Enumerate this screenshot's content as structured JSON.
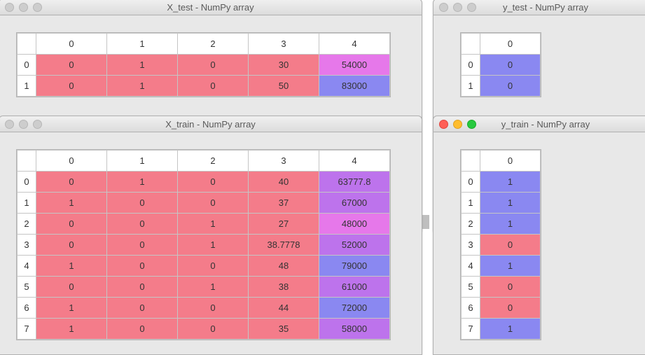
{
  "windows": {
    "x_test": {
      "title": "X_test - NumPy array",
      "active": false,
      "columns": [
        "0",
        "1",
        "2",
        "3",
        "4"
      ],
      "index": [
        "0",
        "1"
      ],
      "cells": [
        [
          {
            "v": "0",
            "c": "red"
          },
          {
            "v": "1",
            "c": "red"
          },
          {
            "v": "0",
            "c": "red"
          },
          {
            "v": "30",
            "c": "red"
          },
          {
            "v": "54000",
            "c": "mag"
          }
        ],
        [
          {
            "v": "0",
            "c": "red"
          },
          {
            "v": "1",
            "c": "red"
          },
          {
            "v": "0",
            "c": "red"
          },
          {
            "v": "50",
            "c": "red"
          },
          {
            "v": "83000",
            "c": "blu"
          }
        ]
      ]
    },
    "y_test": {
      "title": "y_test - NumPy array",
      "active": false,
      "columns": [
        "0"
      ],
      "index": [
        "0",
        "1"
      ],
      "cells": [
        [
          {
            "v": "0",
            "c": "blu"
          }
        ],
        [
          {
            "v": "0",
            "c": "blu"
          }
        ]
      ]
    },
    "x_train": {
      "title": "X_train - NumPy array",
      "active": false,
      "columns": [
        "0",
        "1",
        "2",
        "3",
        "4"
      ],
      "index": [
        "0",
        "1",
        "2",
        "3",
        "4",
        "5",
        "6",
        "7"
      ],
      "cells": [
        [
          {
            "v": "0",
            "c": "red"
          },
          {
            "v": "1",
            "c": "red"
          },
          {
            "v": "0",
            "c": "red"
          },
          {
            "v": "40",
            "c": "red"
          },
          {
            "v": "63777.8",
            "c": "prp"
          }
        ],
        [
          {
            "v": "1",
            "c": "red"
          },
          {
            "v": "0",
            "c": "red"
          },
          {
            "v": "0",
            "c": "red"
          },
          {
            "v": "37",
            "c": "red"
          },
          {
            "v": "67000",
            "c": "prp"
          }
        ],
        [
          {
            "v": "0",
            "c": "red"
          },
          {
            "v": "0",
            "c": "red"
          },
          {
            "v": "1",
            "c": "red"
          },
          {
            "v": "27",
            "c": "red"
          },
          {
            "v": "48000",
            "c": "mag"
          }
        ],
        [
          {
            "v": "0",
            "c": "red"
          },
          {
            "v": "0",
            "c": "red"
          },
          {
            "v": "1",
            "c": "red"
          },
          {
            "v": "38.7778",
            "c": "red"
          },
          {
            "v": "52000",
            "c": "prp"
          }
        ],
        [
          {
            "v": "1",
            "c": "red"
          },
          {
            "v": "0",
            "c": "red"
          },
          {
            "v": "0",
            "c": "red"
          },
          {
            "v": "48",
            "c": "red"
          },
          {
            "v": "79000",
            "c": "blu"
          }
        ],
        [
          {
            "v": "0",
            "c": "red"
          },
          {
            "v": "0",
            "c": "red"
          },
          {
            "v": "1",
            "c": "red"
          },
          {
            "v": "38",
            "c": "red"
          },
          {
            "v": "61000",
            "c": "prp"
          }
        ],
        [
          {
            "v": "1",
            "c": "red"
          },
          {
            "v": "0",
            "c": "red"
          },
          {
            "v": "0",
            "c": "red"
          },
          {
            "v": "44",
            "c": "red"
          },
          {
            "v": "72000",
            "c": "blu"
          }
        ],
        [
          {
            "v": "1",
            "c": "red"
          },
          {
            "v": "0",
            "c": "red"
          },
          {
            "v": "0",
            "c": "red"
          },
          {
            "v": "35",
            "c": "red"
          },
          {
            "v": "58000",
            "c": "prp"
          }
        ]
      ]
    },
    "y_train": {
      "title": "y_train - NumPy array",
      "active": true,
      "columns": [
        "0"
      ],
      "index": [
        "0",
        "1",
        "2",
        "3",
        "4",
        "5",
        "6",
        "7"
      ],
      "cells": [
        [
          {
            "v": "1",
            "c": "blu"
          }
        ],
        [
          {
            "v": "1",
            "c": "blu"
          }
        ],
        [
          {
            "v": "1",
            "c": "blu"
          }
        ],
        [
          {
            "v": "0",
            "c": "red"
          }
        ],
        [
          {
            "v": "1",
            "c": "blu"
          }
        ],
        [
          {
            "v": "0",
            "c": "red"
          }
        ],
        [
          {
            "v": "0",
            "c": "red"
          }
        ],
        [
          {
            "v": "1",
            "c": "blu"
          }
        ]
      ]
    }
  },
  "chart_data": [
    {
      "type": "table",
      "name": "X_test",
      "columns": [
        0,
        1,
        2,
        3,
        4
      ],
      "rows": [
        [
          0,
          1,
          0,
          30,
          54000
        ],
        [
          0,
          1,
          0,
          50,
          83000
        ]
      ]
    },
    {
      "type": "table",
      "name": "y_test",
      "columns": [
        0
      ],
      "rows": [
        [
          0
        ],
        [
          0
        ]
      ]
    },
    {
      "type": "table",
      "name": "X_train",
      "columns": [
        0,
        1,
        2,
        3,
        4
      ],
      "rows": [
        [
          0,
          1,
          0,
          40,
          63777.8
        ],
        [
          1,
          0,
          0,
          37,
          67000
        ],
        [
          0,
          0,
          1,
          27,
          48000
        ],
        [
          0,
          0,
          1,
          38.7778,
          52000
        ],
        [
          1,
          0,
          0,
          48,
          79000
        ],
        [
          0,
          0,
          1,
          38,
          61000
        ],
        [
          1,
          0,
          0,
          44,
          72000
        ],
        [
          1,
          0,
          0,
          35,
          58000
        ]
      ]
    },
    {
      "type": "table",
      "name": "y_train",
      "columns": [
        0
      ],
      "rows": [
        [
          1
        ],
        [
          1
        ],
        [
          1
        ],
        [
          0
        ],
        [
          1
        ],
        [
          0
        ],
        [
          0
        ],
        [
          1
        ]
      ]
    }
  ]
}
